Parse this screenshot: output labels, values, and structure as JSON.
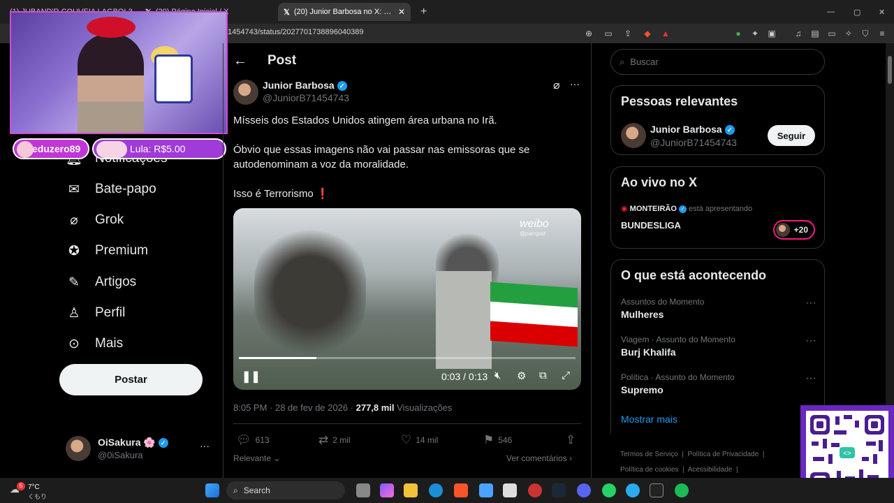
{
  "browser": {
    "tabs": [
      {
        "label": "(1) JUBAND'R COUVEIA LAGBOL3",
        "icon": "youtube-icon"
      },
      {
        "label": "(20) Página Inicial / X",
        "icon": "x-icon"
      },
      {
        "label": "(20) Junior Barbosa no X: \"Mísseis",
        "icon": "x-icon",
        "active": true
      }
    ],
    "new_tab": "+",
    "url": "1454743/status/2027701738896040389",
    "window_controls": [
      "—",
      "▢",
      "✕"
    ]
  },
  "overlay": {
    "chat_user": "eduzero89",
    "donation": "Lula: R$5.00"
  },
  "nav": {
    "items": [
      {
        "label": "Notificações",
        "icon": "bell-icon"
      },
      {
        "label": "Bate-papo",
        "icon": "mail-icon"
      },
      {
        "label": "Grok",
        "icon": "grok-icon"
      },
      {
        "label": "Premium",
        "icon": "verified-badge-icon"
      },
      {
        "label": "Artigos",
        "icon": "article-icon"
      },
      {
        "label": "Perfil",
        "icon": "person-icon"
      },
      {
        "label": "Mais",
        "icon": "more-circle-icon"
      }
    ],
    "post_button": "Postar"
  },
  "account": {
    "name": "OiSakura",
    "emoji": "🌸",
    "handle": "@0iSakura",
    "more": "···"
  },
  "post": {
    "header_title": "Post",
    "author_name": "Junior Barbosa",
    "author_handle": "@JuniorB71454743",
    "text_lines": [
      "Mísseis dos Estados Unidos atingem área urbana no Irã.",
      "Óbvio que essas imagens não vai passar nas emissoras que se autodenominam a voz da moralidade.",
      "Isso é Terrorismo ❗"
    ],
    "video": {
      "watermark": "weibo",
      "watermark_sub": "@paingod",
      "time": "0:03 / 0:13",
      "progress": 0.23
    },
    "timestamp": "8:05 PM · 28 de fev de 2026 · ",
    "views_count": "277,8 mil",
    "views_label": "Visualizações",
    "actions": {
      "replies": "613",
      "reposts": "2 mil",
      "likes": "14 mil",
      "bookmarks": "546"
    },
    "sort_label": "Relevante",
    "see_comments": "Ver comentários"
  },
  "sidebar": {
    "search_placeholder": "Buscar",
    "relevant": {
      "title": "Pessoas relevantes",
      "name": "Junior Barbosa",
      "handle": "@JuniorB71454743",
      "follow": "Seguir"
    },
    "live": {
      "title": "Ao vivo no X",
      "host": "MONTEIRÃO",
      "status": "está apresentando",
      "show": "BUNDESLIGA",
      "count": "+20"
    },
    "trends": {
      "title": "O que está acontecendo",
      "items": [
        {
          "category": "Assuntos do Momento",
          "name": "Mulheres"
        },
        {
          "category": "Viagem · Assunto do Momento",
          "name": "Burj Khalifa"
        },
        {
          "category": "Política · Assunto do Momento",
          "name": "Supremo"
        }
      ],
      "show_more": "Mostrar mais"
    },
    "footer": [
      "Termos de Serviço",
      "Política de Privacidade",
      "Política de cookies",
      "Acessibilidade"
    ]
  },
  "taskbar": {
    "weather_temp": "7°C",
    "weather_desc": "くもり",
    "weather_badge": "5",
    "search": "Search"
  },
  "colors": {
    "accent": "#1d9bf0",
    "background": "#000000",
    "muted": "#71767b",
    "stream_purple": "#a03ad8"
  }
}
